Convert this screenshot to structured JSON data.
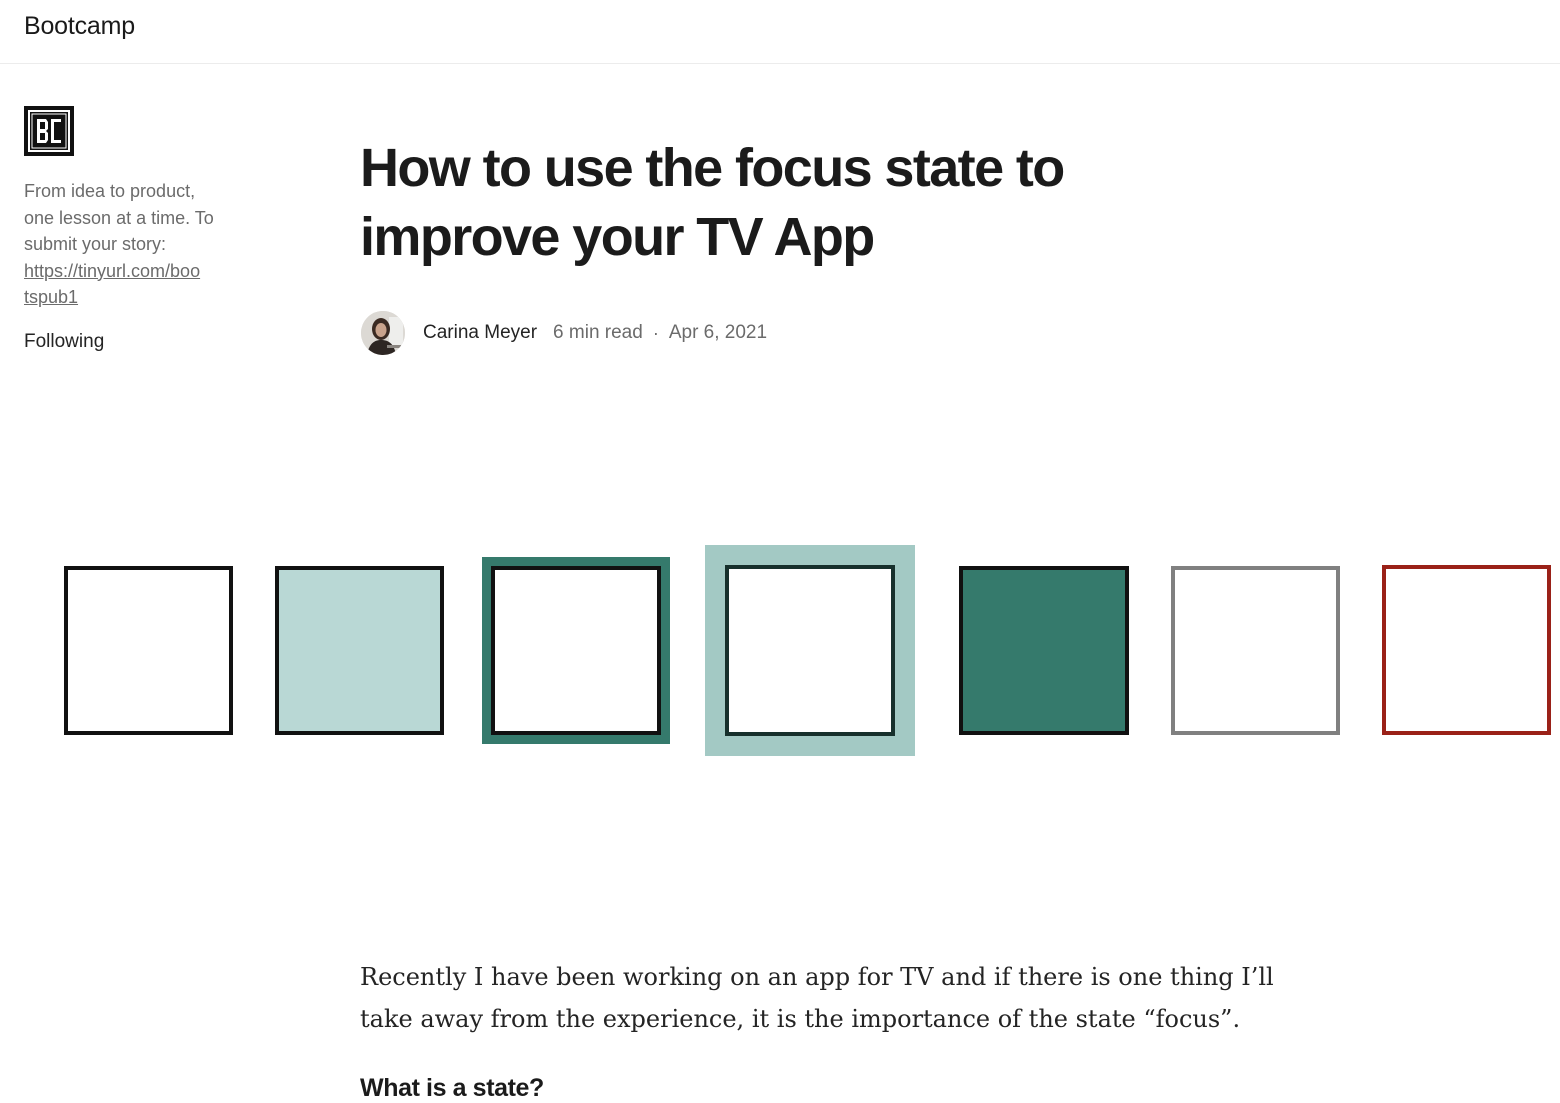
{
  "header": {
    "publication_name": "Bootcamp"
  },
  "sidebar": {
    "logo_icon": "bc-monogram-logo",
    "description_lines": [
      "From idea to product,",
      "one lesson at a time. To",
      "submit your story:"
    ],
    "link_lines": [
      "https://tinyurl.com/boo",
      "tspub1"
    ],
    "follow_status": "Following"
  },
  "article": {
    "title_lines": [
      "How to use the focus state to",
      "improve your TV App"
    ],
    "author": "Carina Meyer",
    "read_time": "6 min read",
    "separator": "·",
    "date": "Apr 6, 2021",
    "body_lines": [
      "Recently I have been working on an app for TV and if there is one thing I’ll",
      "take away from the experience, it is the importance of the state “focus”."
    ],
    "subheading": "What is a state?"
  },
  "colors": {
    "black": "#111111",
    "teal_dark": "#357a6c",
    "teal_light": "#b9d8d5",
    "teal_halo": "#a3c9c4",
    "gray": "#808080",
    "red": "#9a2118"
  }
}
